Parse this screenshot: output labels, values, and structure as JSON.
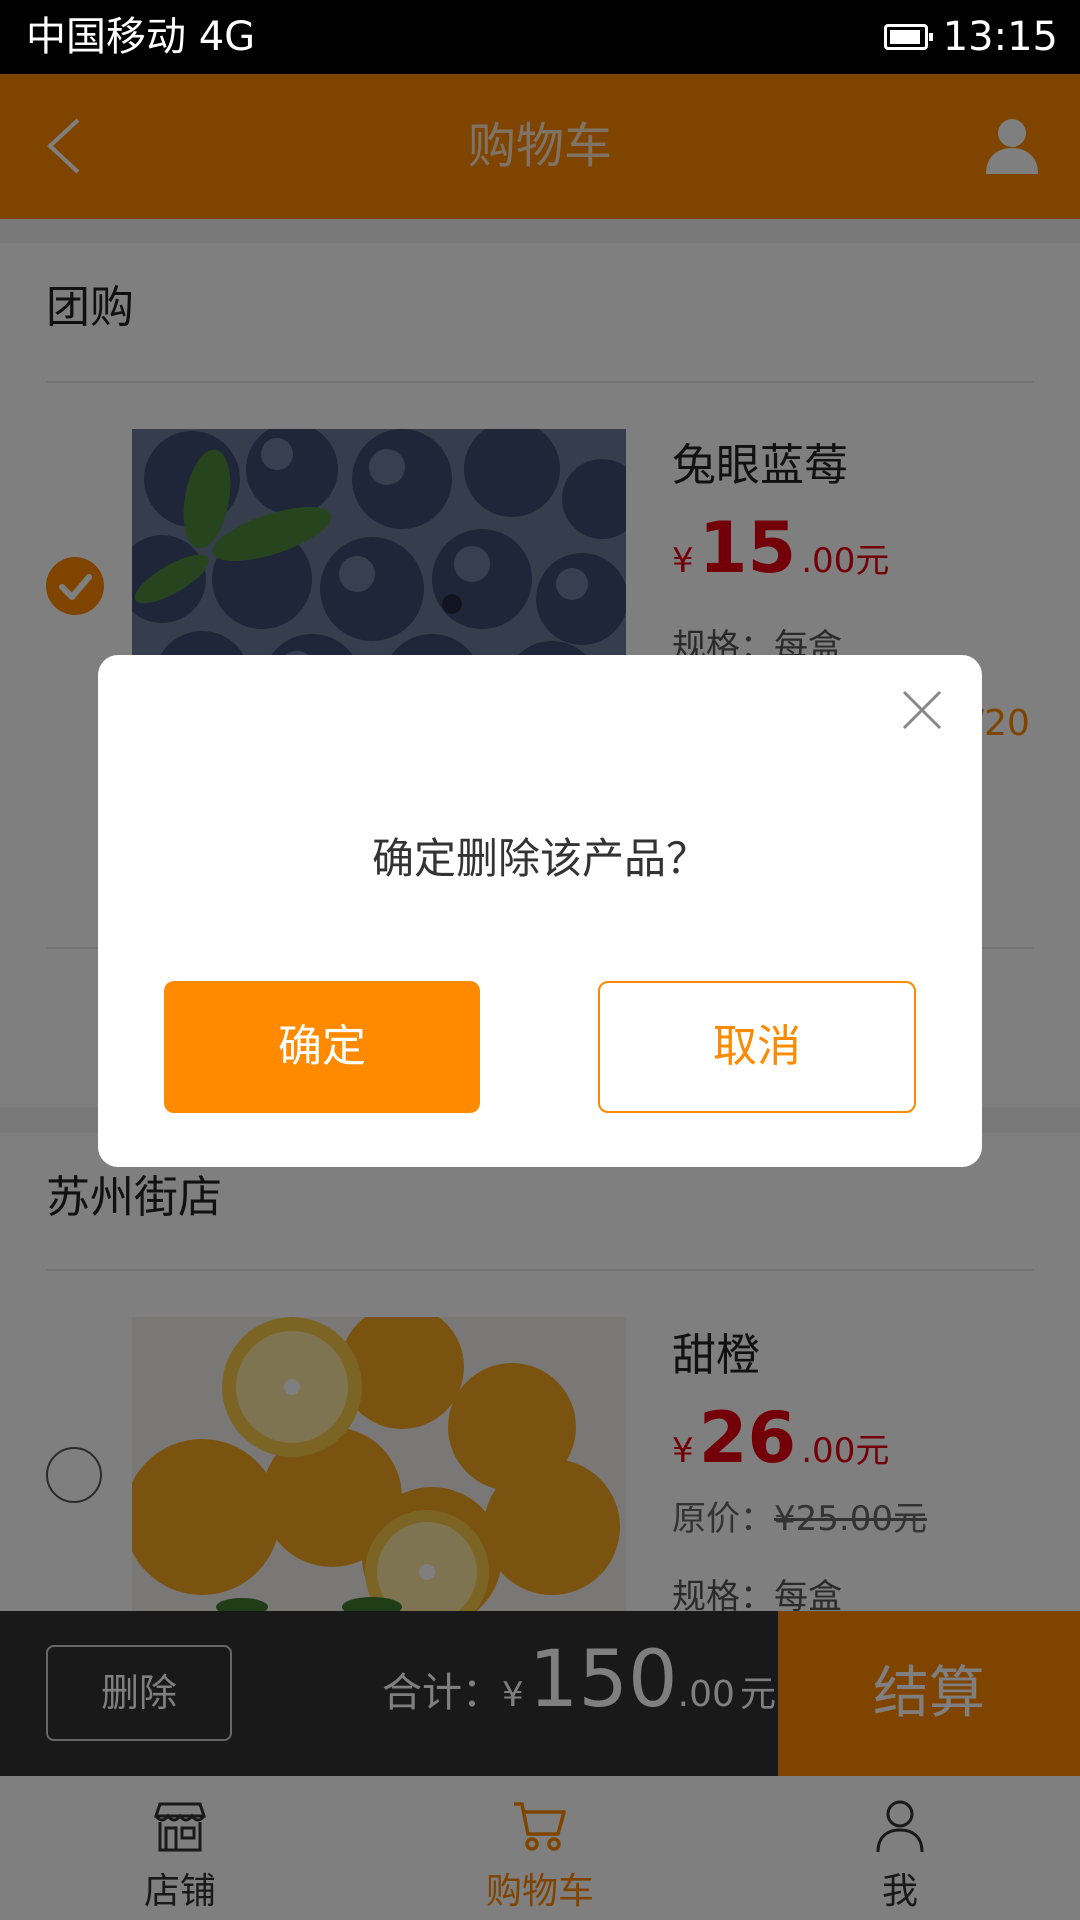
{
  "status_bar": {
    "carrier": "中国移动 4G",
    "time": "13:15"
  },
  "header": {
    "title": "购物车"
  },
  "groups": [
    {
      "title": "团购",
      "item": {
        "checked": true,
        "name": "兔眼蓝莓",
        "price_symbol": "¥",
        "price_int": "15",
        "price_dec": ".00",
        "price_unit": "元",
        "spec": "规格：每盒",
        "quantity_partial": "/20"
      }
    },
    {
      "title": "苏州街店",
      "item": {
        "checked": false,
        "name": "甜橙",
        "price_symbol": "¥",
        "price_int": "26",
        "price_dec": ".00",
        "price_unit": "元",
        "orig_label": "原价：",
        "orig_price": "¥25.00元",
        "spec": "规格：每盒"
      }
    }
  ],
  "checkout": {
    "delete_label": "删除",
    "total_label": "合计：",
    "total_symbol": "¥",
    "total_int": "150",
    "total_dec": ".00",
    "total_unit": "元",
    "checkout_label": "结算"
  },
  "tabs": [
    {
      "label": "店铺",
      "icon": "store-icon"
    },
    {
      "label": "购物车",
      "icon": "cart-icon",
      "active": true
    },
    {
      "label": "我",
      "icon": "user-icon"
    }
  ],
  "dialog": {
    "message": "确定删除该产品？",
    "confirm_label": "确定",
    "cancel_label": "取消"
  },
  "colors": {
    "accent": "#ff8a00",
    "price": "#e60012",
    "dark_bar": "#333333"
  }
}
